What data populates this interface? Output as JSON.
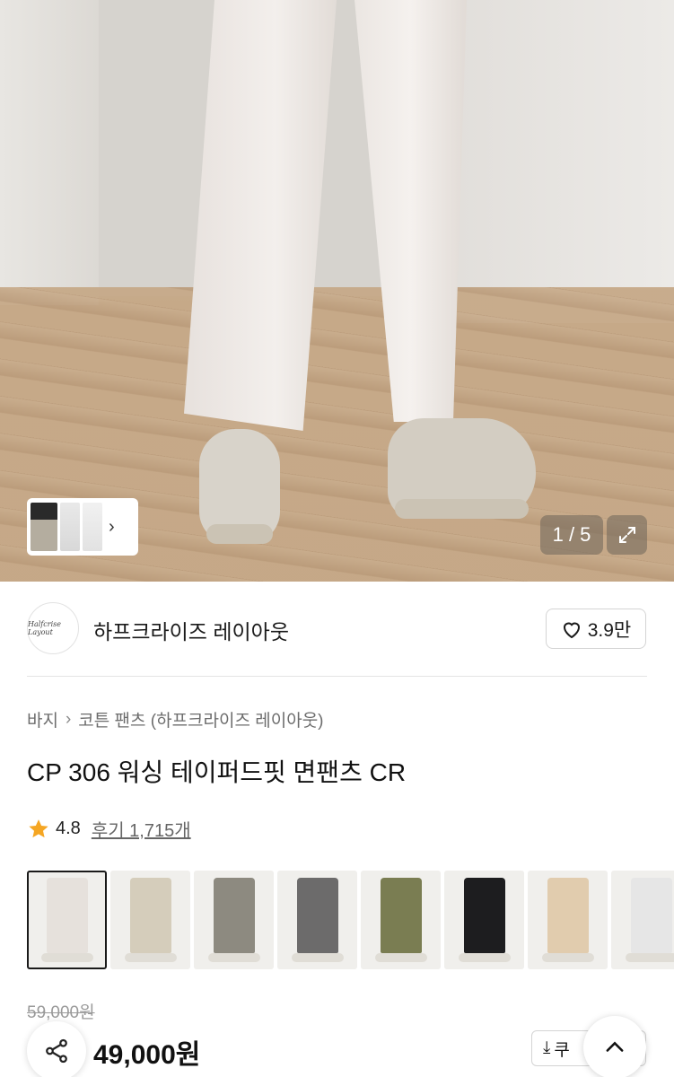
{
  "gallery": {
    "counter": "1 / 5"
  },
  "brand": {
    "logo_text": "Halfcrise Layout",
    "name": "하프크라이즈 레이아웃",
    "likes": "3.9만"
  },
  "breadcrumb": {
    "category": "바지",
    "subcategory": "코튼 팬츠 (하프크라이즈 레이아웃)"
  },
  "product": {
    "title": "CP 306 워싱 테이퍼드핏 면팬츠 CR",
    "rating": "4.8",
    "reviews": "후기 1,715개",
    "original_price": "59,000원",
    "price": "49,000원",
    "coupon_label": "쿠"
  },
  "swatches": [
    {
      "color": "#e6e1dc",
      "selected": true
    },
    {
      "color": "#d5cdbb",
      "selected": false
    },
    {
      "color": "#8d8a80",
      "selected": false
    },
    {
      "color": "#6c6b6b",
      "selected": false
    },
    {
      "color": "#7a7d52",
      "selected": false
    },
    {
      "color": "#1d1d1f",
      "selected": false
    },
    {
      "color": "#e1ccae",
      "selected": false
    },
    {
      "color": "#e6e6e6",
      "selected": false
    }
  ],
  "colors": {
    "star": "#f5a623"
  }
}
